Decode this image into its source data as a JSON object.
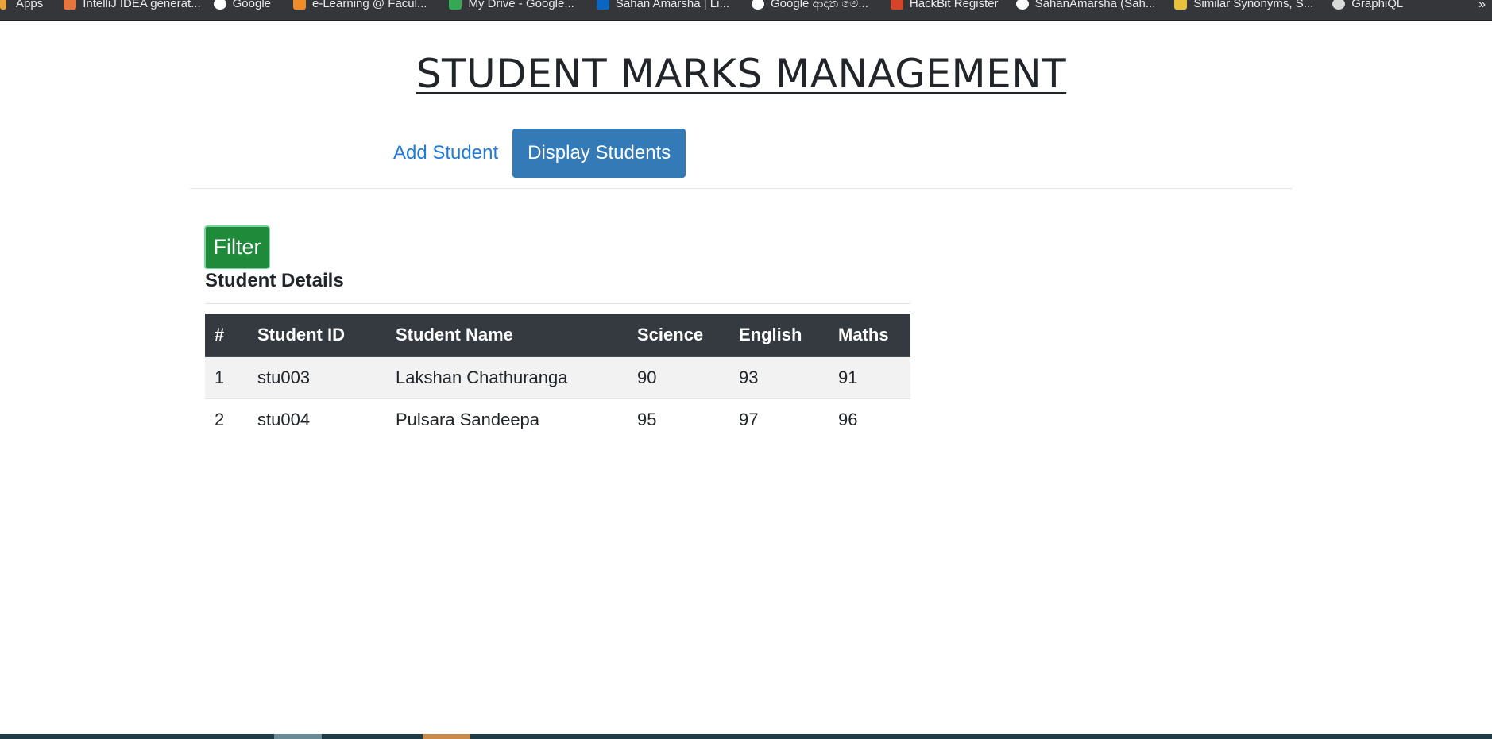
{
  "bookmarks": [
    {
      "label": "Apps",
      "icon": "apps-grid-icon",
      "color": "#e8a33d"
    },
    {
      "label": "IntelliJ IDEA generat...",
      "icon": "intellij-icon",
      "color": "#e8753d"
    },
    {
      "label": "Google",
      "icon": "google-icon",
      "color": "#ffffff"
    },
    {
      "label": "e-Learning @ Facul...",
      "icon": "moodle-icon",
      "color": "#f28c28"
    },
    {
      "label": "My Drive - Google...",
      "icon": "drive-icon",
      "color": "#34a853"
    },
    {
      "label": "Sahan Amarsha | Li...",
      "icon": "linkedin-icon",
      "color": "#0a66c2"
    },
    {
      "label": "Google ආදාන මෙ...",
      "icon": "google-icon",
      "color": "#ffffff"
    },
    {
      "label": "HackBit Register",
      "icon": "hackbit-icon",
      "color": "#d6452a"
    },
    {
      "label": "SahanAmarsha (Sah...",
      "icon": "github-icon",
      "color": "#ffffff"
    },
    {
      "label": "Similar Synonyms, S...",
      "icon": "synonyms-icon",
      "color": "#e8c23d"
    },
    {
      "label": "GraphiQL",
      "icon": "graphiql-icon",
      "color": "#d9d9d9"
    }
  ],
  "bookmarks_overflow": "»",
  "page_title": "STUDENT MARKS MANAGEMENT",
  "nav": {
    "add_student": "Add Student",
    "display_students": "Display Students"
  },
  "filter_button": "Filter",
  "section_title": "Student Details",
  "table": {
    "headers": [
      "#",
      "Student ID",
      "Student Name",
      "Science",
      "English",
      "Maths"
    ],
    "rows": [
      [
        "1",
        "stu003",
        "Lakshan Chathuranga",
        "90",
        "93",
        "91"
      ],
      [
        "2",
        "stu004",
        "Pulsara Sandeepa",
        "95",
        "97",
        "96"
      ]
    ]
  },
  "colors": {
    "nav_active_bg": "#337ab7",
    "link": "#1f7ad8",
    "filter_bg": "#1e8a3a",
    "table_header_bg": "#343a40"
  }
}
